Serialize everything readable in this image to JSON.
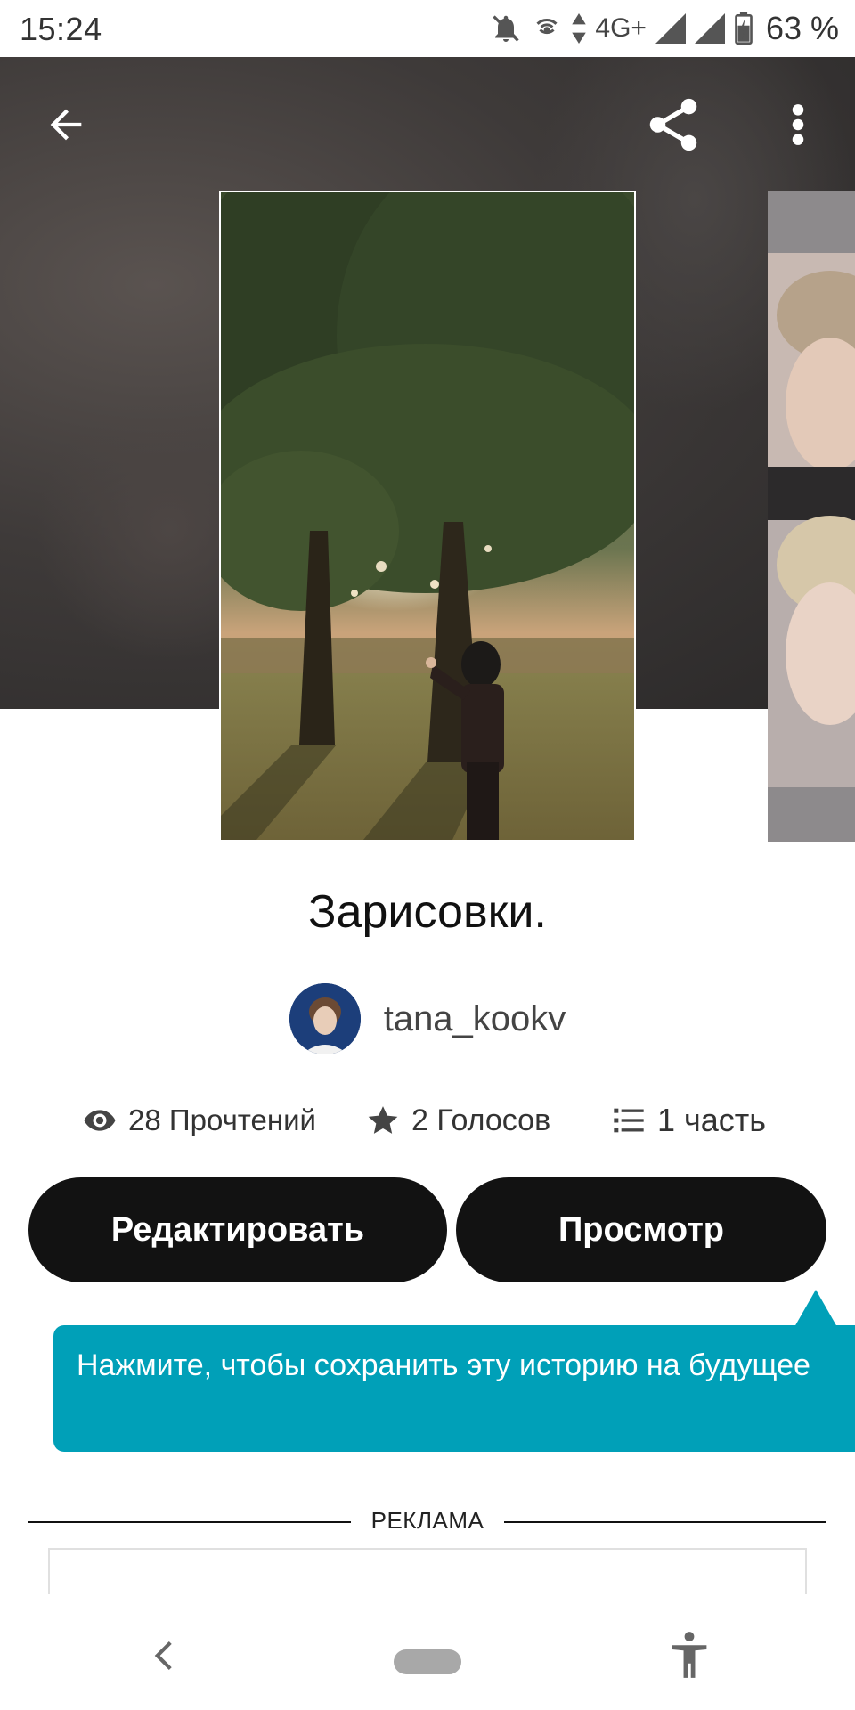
{
  "status_bar": {
    "time": "15:24",
    "network": "4G+",
    "battery": "63 %",
    "icons": [
      "bell-off-icon",
      "hotspot-icon",
      "data-arrows-icon",
      "signal-icon",
      "signal-icon",
      "battery-icon"
    ]
  },
  "toolbar": {
    "back_icon": "arrow-left-icon",
    "share_icon": "share-icon",
    "more_icon": "more-vertical-icon"
  },
  "story": {
    "title": "Зарисовки.",
    "author": "tana_kookv",
    "stats": {
      "reads": "28 Прочтений",
      "votes": "2 Голосов",
      "parts": "1 часть"
    }
  },
  "actions": {
    "edit_label": "Редактировать",
    "view_label": "Просмотр"
  },
  "tooltip": {
    "text": "Нажмите, чтобы сохранить эту историю на будущее"
  },
  "ad": {
    "label": "РЕКЛАМА"
  },
  "nav": {
    "back_icon": "nav-back-icon",
    "home_icon": "home-pill-icon",
    "accessibility_icon": "accessibility-icon"
  },
  "colors": {
    "accent_teal": "#00a0b8",
    "button_dark": "#121212",
    "hero_bg": "#3e3a39"
  }
}
